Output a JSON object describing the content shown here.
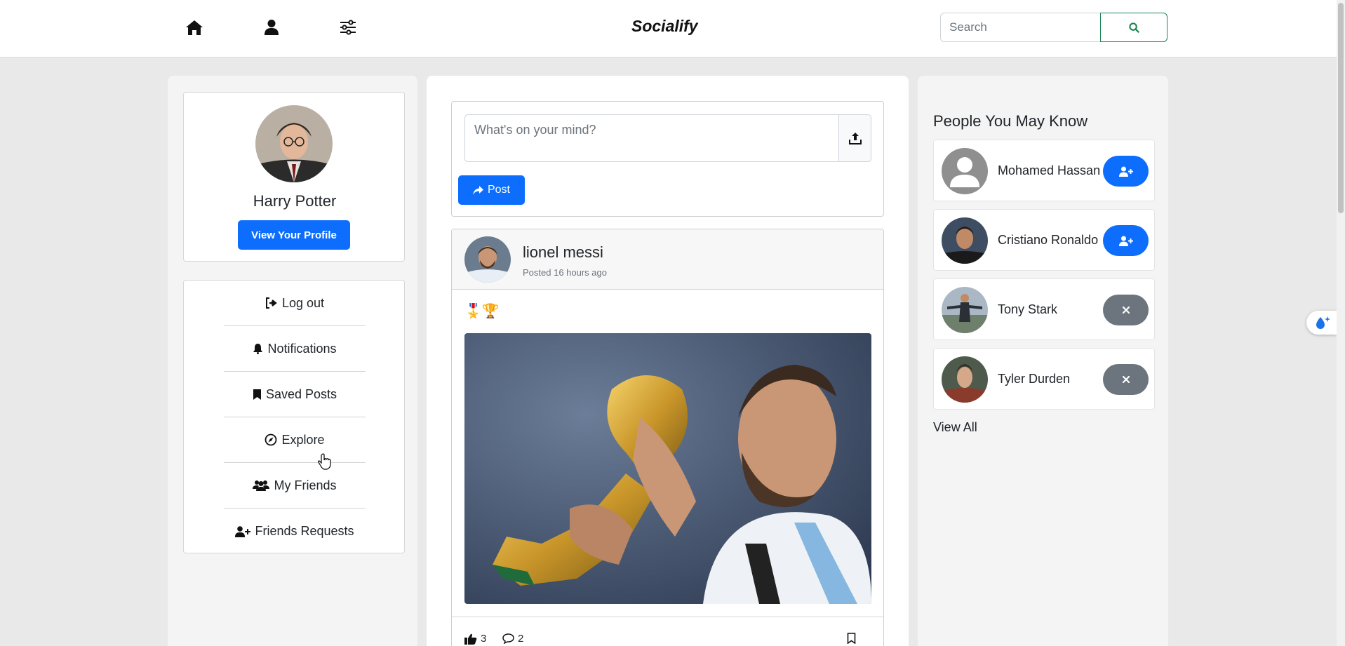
{
  "nav": {
    "brand": "Socialify",
    "icons": [
      "home-icon",
      "user-icon",
      "sliders-icon"
    ],
    "search": {
      "placeholder": "Search",
      "value": ""
    }
  },
  "profile": {
    "name": "Harry Potter",
    "view_profile_label": "View Your Profile"
  },
  "menu": {
    "items": [
      {
        "label": "Log out",
        "icon": "sign-out-icon"
      },
      {
        "label": "Notifications",
        "icon": "bell-icon"
      },
      {
        "label": "Saved Posts",
        "icon": "bookmark-icon"
      },
      {
        "label": "Explore",
        "icon": "compass-icon"
      },
      {
        "label": "My Friends",
        "icon": "users-icon"
      },
      {
        "label": "Friends Requests",
        "icon": "user-plus-icon"
      }
    ]
  },
  "composer": {
    "placeholder": "What's on your mind?",
    "post_label": "Post"
  },
  "post": {
    "author": "lionel messi",
    "time": "Posted 16 hours ago",
    "emojis": "🎖️🏆",
    "likes": "3",
    "comments": "2"
  },
  "people": {
    "title": "People You May Know",
    "items": [
      {
        "name": "Mohamed Hassan",
        "action": "add"
      },
      {
        "name": "Cristiano Ronaldo",
        "action": "add"
      },
      {
        "name": "Tony Stark",
        "action": "remove"
      },
      {
        "name": "Tyler Durden",
        "action": "remove"
      }
    ],
    "view_all": "View All"
  },
  "colors": {
    "primary": "#0d6efd",
    "secondary": "#6c757d",
    "success": "#198754",
    "page_bg": "#e9e9e9"
  }
}
